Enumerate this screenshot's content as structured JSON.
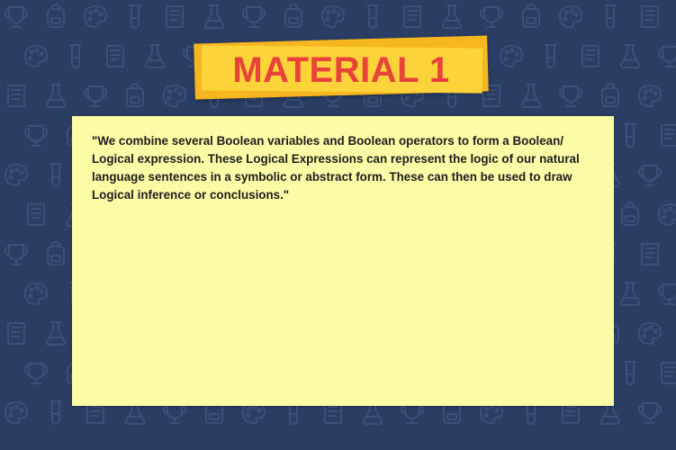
{
  "banner": {
    "title": "MATERIAL 1"
  },
  "note": {
    "text": "\"We combine several Boolean variables and Boolean operators to form a Boolean/ Logical expression. These Logical Expressions can represent the logic of our natural language sentences in a symbolic or abstract form. These can then be used to draw Logical inference or conclusions.\""
  },
  "colors": {
    "background": "#2a3d62",
    "pattern": "#3a5079",
    "banner_back": "#f5b61f",
    "banner_front": "#fcd43a",
    "title": "#e8423a",
    "note": "#fcfca6",
    "text": "#1e1e1e"
  },
  "icons": [
    "trophy-icon",
    "backpack-icon",
    "palette-icon",
    "test-tube-icon",
    "book-icon",
    "flask-icon"
  ]
}
